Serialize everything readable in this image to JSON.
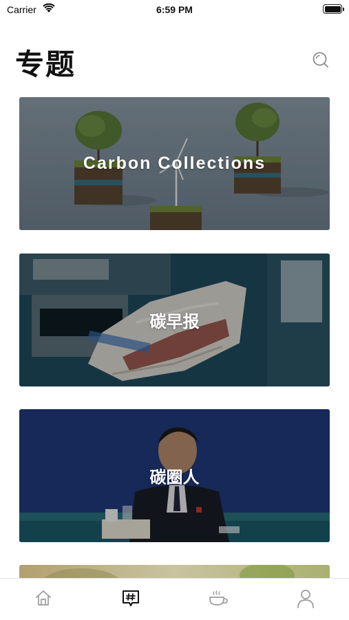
{
  "status_bar": {
    "carrier": "Carrier",
    "time": "6:59 PM"
  },
  "header": {
    "title": "专题",
    "search_icon": "search-icon"
  },
  "cards": [
    {
      "title": "Carbon Collections",
      "image": "trees-on-soil-cubes-with-wind-turbine"
    },
    {
      "title": "碳早报",
      "image": "newspaper-in-mail-slot"
    },
    {
      "title": "碳圈人",
      "image": "speaker-at-press-conference"
    },
    {
      "title": "",
      "image": "blurred-green-leaves"
    }
  ],
  "tab_bar": {
    "items": [
      {
        "icon": "home-icon",
        "active": false
      },
      {
        "icon": "topic-hash-icon",
        "active": true
      },
      {
        "icon": "coffee-cup-icon",
        "active": false
      },
      {
        "icon": "profile-icon",
        "active": false
      }
    ],
    "active_color": "#111111",
    "inactive_color": "#9a9a9a"
  }
}
